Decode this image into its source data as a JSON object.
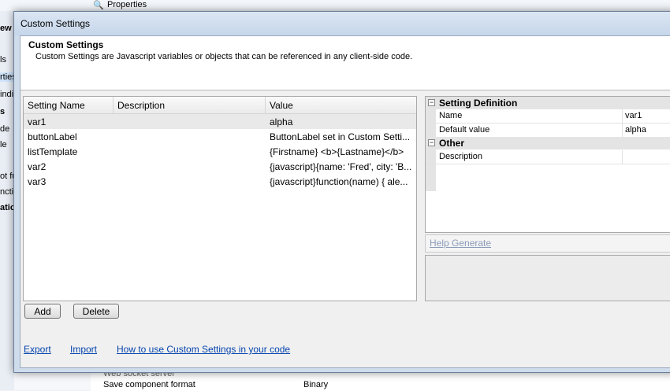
{
  "background": {
    "properties_label": "Properties",
    "left_fragments": [
      "ew",
      "ls",
      "rties",
      "indi",
      "s",
      "de",
      "le",
      "ot fu",
      "ncti",
      "atio"
    ],
    "bottom_rows": [
      {
        "name": "Web socket server",
        "value": ""
      },
      {
        "name": "Save component format",
        "value": "Binary"
      }
    ]
  },
  "dialog": {
    "title": "Custom Settings",
    "header_title": "Custom Settings",
    "header_subtitle": "Custom Settings are Javascript variables or objects that can be referenced in any client-side code."
  },
  "grid": {
    "columns": [
      "Setting Name",
      "Description",
      "Value"
    ],
    "rows": [
      {
        "name": "var1",
        "description": "",
        "value": "alpha"
      },
      {
        "name": "buttonLabel",
        "description": "",
        "value": "ButtonLabel set in Custom Setti..."
      },
      {
        "name": "listTemplate",
        "description": "",
        "value": "{Firstname} <b>{Lastname}</b>"
      },
      {
        "name": "var2",
        "description": "",
        "value": "{javascript}{name: 'Fred', city: 'B..."
      },
      {
        "name": "var3",
        "description": "",
        "value": "{javascript}function(name) {  ale..."
      }
    ],
    "selected_index": 0
  },
  "buttons": {
    "add": "Add",
    "delete": "Delete"
  },
  "links": {
    "export": "Export",
    "import": "Import",
    "howto": "How to use Custom Settings in your code"
  },
  "property_grid": {
    "categories": [
      {
        "title": "Setting Definition",
        "expander": "−",
        "rows": [
          {
            "key": "Name",
            "value": "var1"
          },
          {
            "key": "Default value",
            "value": "alpha"
          }
        ]
      },
      {
        "title": "Other",
        "expander": "−",
        "rows": [
          {
            "key": "Description",
            "value": ""
          }
        ]
      }
    ]
  },
  "help_generate": "Help Generate",
  "colors": {
    "link": "#0645ad",
    "disabled_link": "#8a9bb8",
    "title_bar": "#cfdcec"
  }
}
